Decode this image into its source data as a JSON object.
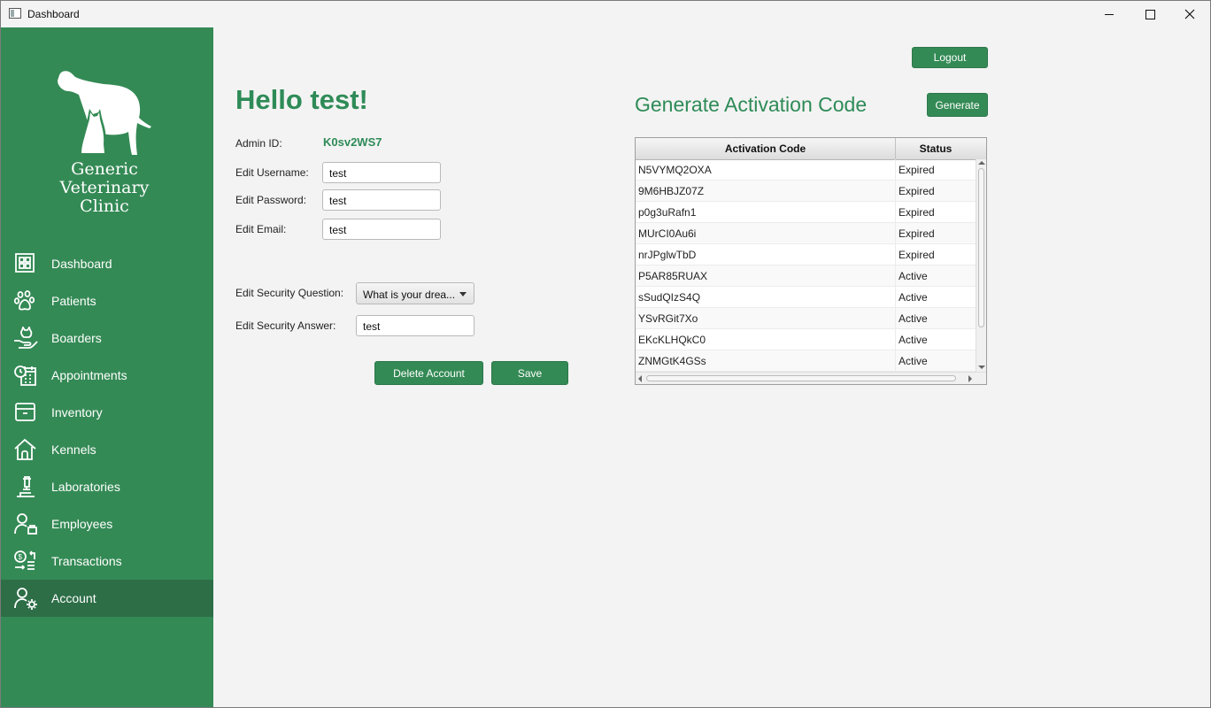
{
  "window": {
    "title": "Dashboard"
  },
  "sidebar": {
    "brand_lines": [
      "Generic",
      "Veterinary",
      "Clinic"
    ],
    "items": [
      {
        "label": "Dashboard",
        "icon": "dashboard-grid-icon"
      },
      {
        "label": "Patients",
        "icon": "paw-icon"
      },
      {
        "label": "Boarders",
        "icon": "boarder-cat-icon"
      },
      {
        "label": "Appointments",
        "icon": "calendar-clock-icon"
      },
      {
        "label": "Inventory",
        "icon": "inventory-box-icon"
      },
      {
        "label": "Kennels",
        "icon": "house-icon"
      },
      {
        "label": "Laboratories",
        "icon": "microscope-icon"
      },
      {
        "label": "Employees",
        "icon": "employee-icon"
      },
      {
        "label": "Transactions",
        "icon": "transactions-icon"
      },
      {
        "label": "Account",
        "icon": "account-gear-icon"
      }
    ],
    "active_item": "Account"
  },
  "header": {
    "logout_label": "Logout"
  },
  "profile": {
    "greeting": "Hello test!",
    "admin_id_label": "Admin ID:",
    "admin_id_value": "K0sv2WS7",
    "username_label": "Edit Username:",
    "username_value": "test",
    "password_label": "Edit Password:",
    "password_value": "test",
    "email_label": "Edit Email:",
    "email_value": "test",
    "security_question_label": "Edit Security Question:",
    "security_question_value": "What is your drea...",
    "security_answer_label": "Edit Security Answer:",
    "security_answer_value": "test",
    "delete_label": "Delete Account",
    "save_label": "Save"
  },
  "activation": {
    "title": "Generate Activation Code",
    "generate_label": "Generate",
    "columns": [
      "Activation Code",
      "Status"
    ],
    "rows": [
      {
        "code": "N5VYMQ2OXA",
        "status": "Expired"
      },
      {
        "code": "9M6HBJZ07Z",
        "status": "Expired"
      },
      {
        "code": "p0g3uRafn1",
        "status": "Expired"
      },
      {
        "code": "MUrCI0Au6i",
        "status": "Expired"
      },
      {
        "code": "nrJPglwTbD",
        "status": "Expired"
      },
      {
        "code": "P5AR85RUAX",
        "status": "Active"
      },
      {
        "code": "sSudQIzS4Q",
        "status": "Active"
      },
      {
        "code": "YSvRGit7Xo",
        "status": "Active"
      },
      {
        "code": "EKcKLHQkC0",
        "status": "Active"
      },
      {
        "code": "ZNMGtK4GSs",
        "status": "Active"
      }
    ]
  },
  "colors": {
    "brand_green": "#348a55",
    "active_nav": "#2d6e47",
    "heading_green": "#2e8b57"
  }
}
